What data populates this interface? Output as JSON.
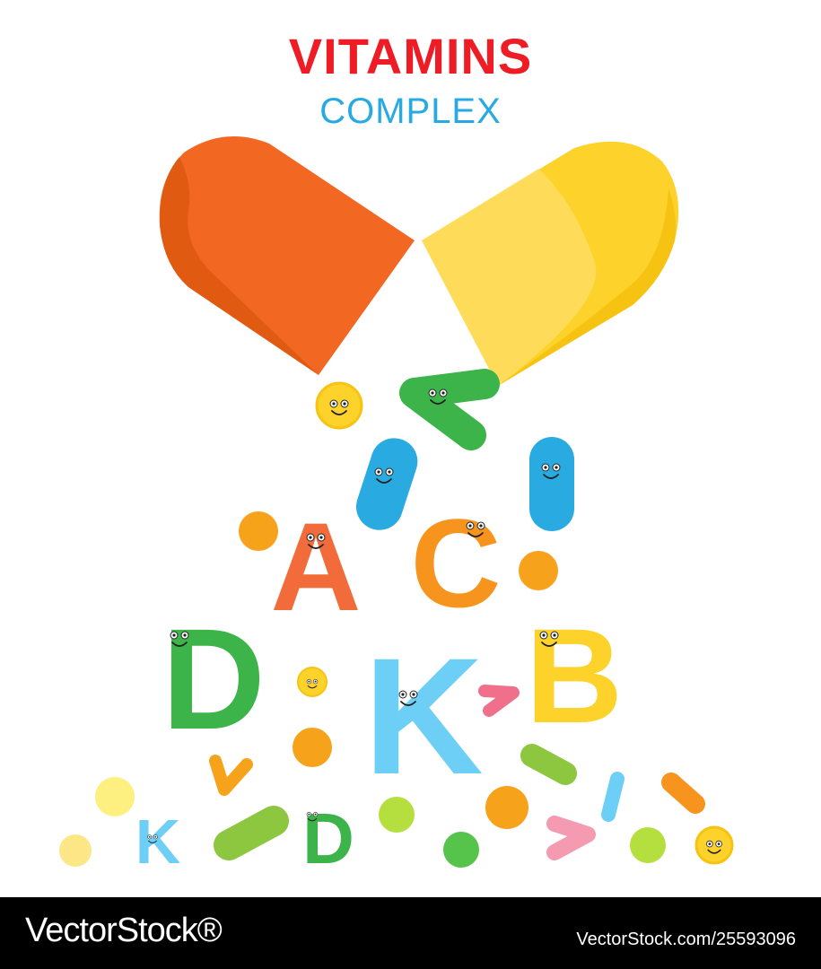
{
  "header": {
    "title": "VITAMINS",
    "subtitle": "COMPLEX"
  },
  "letters": [
    "A",
    "C",
    "D",
    "K",
    "B",
    "K",
    "D"
  ],
  "colors": {
    "title": "#ee1c25",
    "subtitle": "#27aae1",
    "capsule_left": "#f26722",
    "capsule_right": "#fdd32b",
    "letter_a": "#f26b3a",
    "letter_c": "#f7941d",
    "letter_d": "#3cb44a",
    "letter_k": "#6dcff6",
    "letter_b": "#fdd32b"
  },
  "icons": [
    "smiley-coin-icon",
    "smiley-pill-icon",
    "vitamin-letter-icon",
    "dot-icon"
  ],
  "footer": {
    "brand": "VectorStock®",
    "image_id": "VectorStock.com/25593096"
  }
}
